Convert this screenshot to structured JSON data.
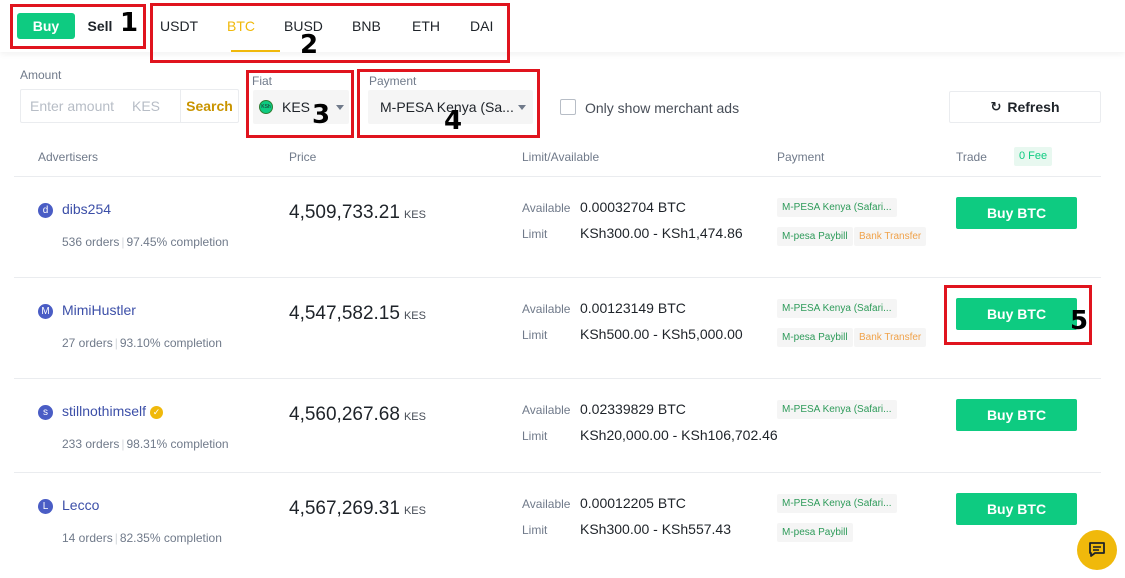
{
  "trade_side": {
    "buy_label": "Buy",
    "sell_label": "Sell"
  },
  "assets": [
    "USDT",
    "BTC",
    "BUSD",
    "BNB",
    "ETH",
    "DAI"
  ],
  "active_asset": "BTC",
  "filters": {
    "amount_label": "Amount",
    "amount_placeholder": "Enter amount",
    "amount_unit": "KES",
    "search_label": "Search",
    "fiat_label": "Fiat",
    "fiat_value": "KES",
    "fiat_icon_text": "KSh",
    "payment_label": "Payment",
    "payment_value": "M-PESA Kenya (Sa...",
    "merchant_only_label": "Only show merchant ads",
    "merchant_only_checked": false,
    "refresh_label": "Refresh"
  },
  "table": {
    "headers": {
      "advertisers": "Advertisers",
      "price": "Price",
      "limit": "Limit/Available",
      "payment": "Payment",
      "trade": "Trade",
      "fee_badge": "0 Fee"
    },
    "available_label": "Available",
    "limit_label": "Limit",
    "rows": [
      {
        "initial": "d",
        "name": "dibs254",
        "verified": false,
        "orders": "536 orders",
        "completion": "97.45% completion",
        "price": "4,509,733.21",
        "currency": "KES",
        "available": "0.00032704 BTC",
        "limit": "KSh300.00 - KSh1,474.86",
        "payments": [
          "M-PESA Kenya (Safari...",
          "M-pesa Paybill",
          "Bank Transfer"
        ],
        "action": "Buy BTC"
      },
      {
        "initial": "M",
        "name": "MimiHustler",
        "verified": false,
        "orders": "27 orders",
        "completion": "93.10% completion",
        "price": "4,547,582.15",
        "currency": "KES",
        "available": "0.00123149 BTC",
        "limit": "KSh500.00 - KSh5,000.00",
        "payments": [
          "M-PESA Kenya (Safari...",
          "M-pesa Paybill",
          "Bank Transfer"
        ],
        "action": "Buy BTC"
      },
      {
        "initial": "s",
        "name": "stillnothimself",
        "verified": true,
        "orders": "233 orders",
        "completion": "98.31% completion",
        "price": "4,560,267.68",
        "currency": "KES",
        "available": "0.02339829 BTC",
        "limit": "KSh20,000.00 - KSh106,702.46",
        "payments": [
          "M-PESA Kenya (Safari..."
        ],
        "action": "Buy BTC"
      },
      {
        "initial": "L",
        "name": "Lecco",
        "verified": false,
        "orders": "14 orders",
        "completion": "82.35% completion",
        "price": "4,567,269.31",
        "currency": "KES",
        "available": "0.00012205 BTC",
        "limit": "KSh300.00 - KSh557.43",
        "payments": [
          "M-PESA Kenya (Safari...",
          "M-pesa Paybill"
        ],
        "action": "Buy BTC"
      }
    ]
  },
  "annotations": [
    "1",
    "2",
    "3",
    "4",
    "5"
  ],
  "colors": {
    "buy_green": "#0ecb81",
    "accent_yellow": "#f0b90b",
    "annotation_red": "#e0141e"
  },
  "icons": {
    "refresh": "refresh-icon",
    "chat": "chat-icon",
    "verified": "verified-badge-icon"
  }
}
